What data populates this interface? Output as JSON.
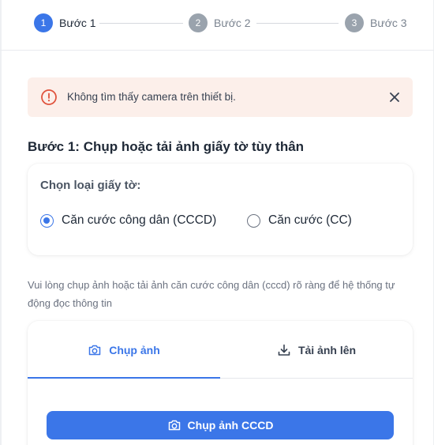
{
  "stepper": {
    "steps": [
      {
        "number": "1",
        "label": "Bước 1",
        "state": "active"
      },
      {
        "number": "2",
        "label": "Bước 2",
        "state": "inactive"
      },
      {
        "number": "3",
        "label": "Bước 3",
        "state": "inactive"
      }
    ]
  },
  "alert": {
    "message": "Không tìm thấy camera trên thiết bị.",
    "icon": "alert-circle-icon",
    "close_icon": "close-icon"
  },
  "section": {
    "title": "Bước 1: Chụp hoặc tải ảnh giấy tờ tùy thân"
  },
  "doc_type": {
    "label": "Chọn loại giấy tờ:",
    "options": [
      {
        "label": "Căn cước công dân (CCCD)",
        "selected": true
      },
      {
        "label": "Căn cước (CC)",
        "selected": false
      }
    ]
  },
  "instruction": "Vui lòng chụp ảnh hoặc tải ảnh căn cước công dân (cccd) rõ ràng để hệ thống tự động đọc thông tin",
  "capture": {
    "tabs": [
      {
        "label": "Chụp ảnh",
        "icon": "camera-icon",
        "active": true
      },
      {
        "label": "Tải ảnh lên",
        "icon": "upload-icon",
        "active": false
      }
    ],
    "button_label": "Chụp ảnh CCCD",
    "button_icon": "camera-icon"
  },
  "colors": {
    "primary": "#3b76e8",
    "alert_bg": "#fcefea",
    "alert_accent": "#e0533d",
    "inactive_step": "#9aa3ad"
  }
}
